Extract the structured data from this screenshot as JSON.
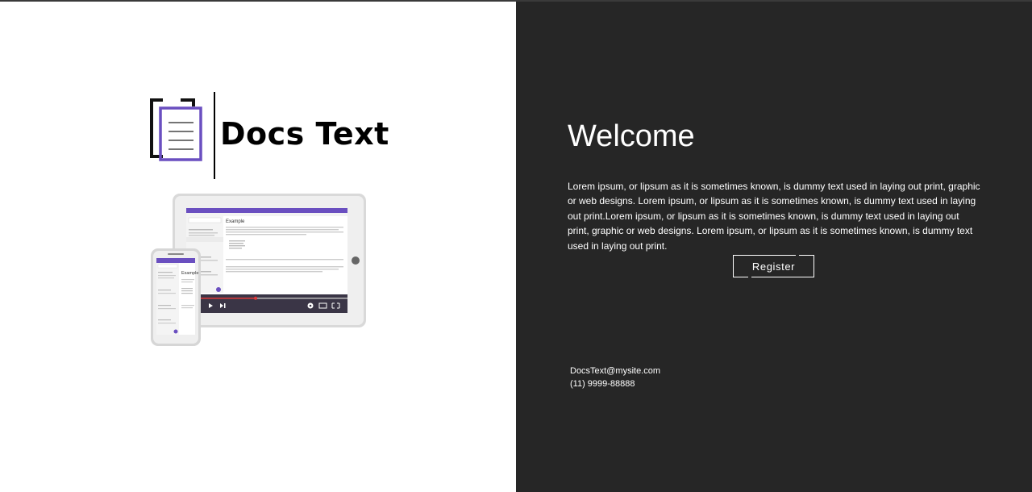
{
  "brand": {
    "name": "Docs Text",
    "accent_color": "#6a4fc0"
  },
  "devices": {
    "tablet_doc_title": "Example",
    "phone_doc_title": "Example"
  },
  "welcome": {
    "title": "Welcome",
    "body": "Lorem ipsum, or lipsum as it is sometimes known, is dummy text used in laying out print, graphic or web designs. Lorem ipsum, or lipsum as it is sometimes known, is dummy text used in laying out print.Lorem ipsum, or lipsum as it is sometimes known, is dummy text used in laying out print, graphic or web designs. Lorem ipsum, or lipsum as it is sometimes known, is dummy text used in laying out print.",
    "register_label": "Register"
  },
  "contact": {
    "email": "DocsText@mysite.com",
    "phone": "(11) 9999-88888"
  },
  "colors": {
    "dark_panel": "#262626",
    "light_panel": "#ffffff",
    "video_bar": "#3a3546",
    "progress": "#e03a3a"
  }
}
